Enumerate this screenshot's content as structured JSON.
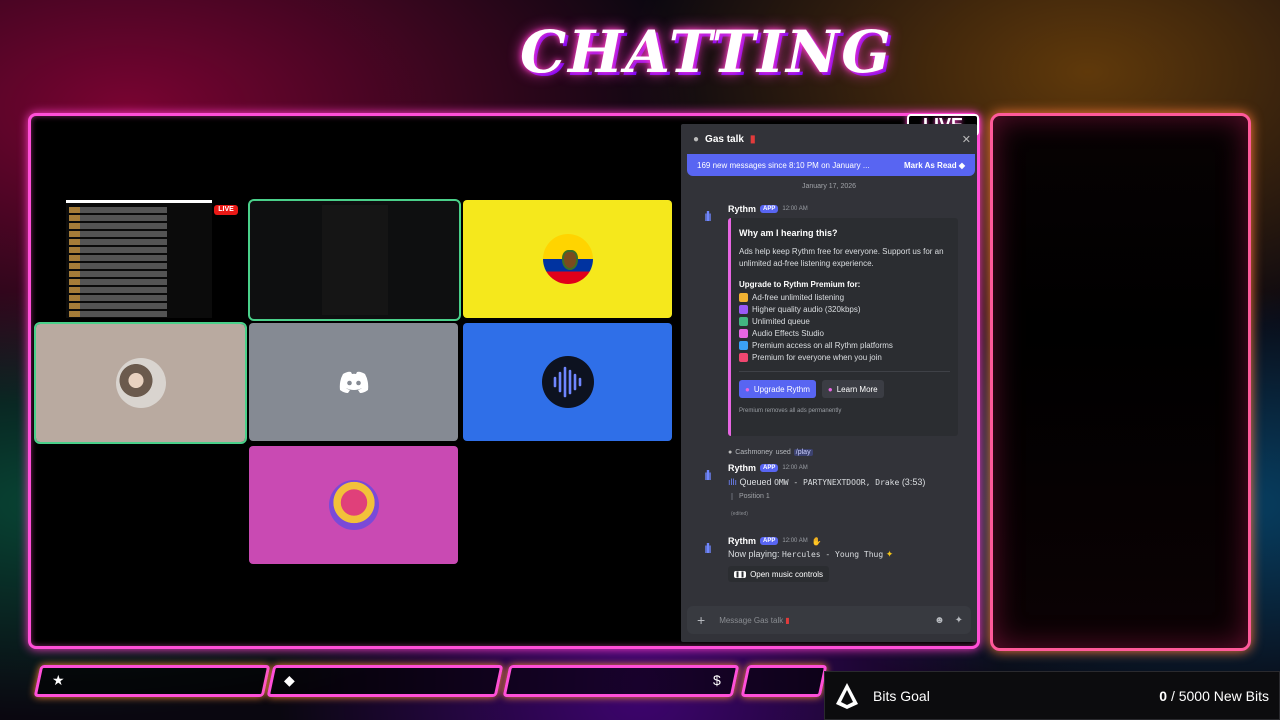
{
  "scene": {
    "title": "CHATTING",
    "live_badge": "LIVE"
  },
  "call_grid": {
    "mini_stream_badge": "LIVE"
  },
  "discord": {
    "channel_name": "Gas talk",
    "new_messages": "169 new messages since 8:10 PM on January ...",
    "mark_read": "Mark As Read",
    "date_divider": "January 17, 2026",
    "msg1": {
      "author": "Rythm",
      "tag": "APP",
      "time": "12:00 AM",
      "embed_title": "Why am I hearing this?",
      "embed_desc": "Ads help keep Rythm free for everyone. Support us for an unlimited ad-free listening experience.",
      "features_heading": "Upgrade to Rythm Premium for:",
      "features": [
        {
          "label": "Ad-free unlimited listening",
          "color": "#f0b232"
        },
        {
          "label": "Higher quality audio (320kbps)",
          "color": "#9b59f6"
        },
        {
          "label": "Unlimited queue",
          "color": "#43b581"
        },
        {
          "label": "Audio Effects Studio",
          "color": "#e766e2"
        },
        {
          "label": "Premium access on all Rythm platforms",
          "color": "#3ba1f5"
        },
        {
          "label": "Premium for everyone when you join",
          "color": "#f04770"
        }
      ],
      "btn_upgrade": "Upgrade Rythm",
      "btn_learn": "Learn More",
      "footer": "Premium removes all ads permanently"
    },
    "msg2": {
      "reply_user": "Cashmoney",
      "reply_used": "used",
      "reply_cmd": "/play",
      "author": "Rythm",
      "tag": "APP",
      "time": "12:00 AM",
      "queued_label": "Queued",
      "queued_track": "OMW - PARTYNEXTDOOR, Drake",
      "queued_dur": "(3:53)",
      "position": "Position 1",
      "edited": "(edited)"
    },
    "msg3": {
      "author": "Rythm",
      "tag": "APP",
      "time": "12:00 AM",
      "now_label": "Now playing:",
      "now_track": "Hercules - Young Thug",
      "controls": "Open music controls"
    },
    "input_placeholder": "Message Gas talk"
  },
  "bits_goal": {
    "label": "Bits Goal",
    "current": "0",
    "goal_suffix": "/ 5000 New Bits"
  },
  "colors": {
    "accent": "#ff4fd8",
    "blurple": "#5865f2",
    "tile_yellow": "#f5e81c",
    "tile_blue": "#2f6fe8",
    "tile_pink": "#c94ab3",
    "tile_gray": "#858a93",
    "tile_beige": "#b9aaa0"
  },
  "icons": {
    "tile_discord": "discord-logo-icon",
    "tile_rythm": "rythm-wave-icon",
    "bar1": "star-icon",
    "bar2": "diamond-icon",
    "bar3": "dollar-icon"
  }
}
